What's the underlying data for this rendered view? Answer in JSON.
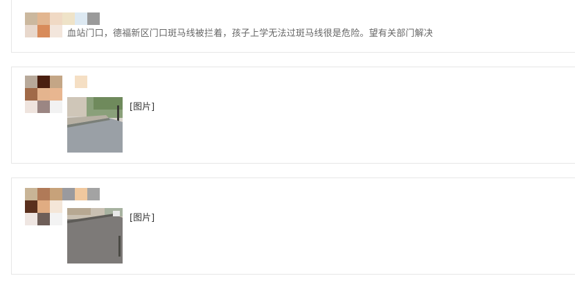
{
  "posts": [
    {
      "text": "血站门口，德福新区门口斑马线被拦着，孩子上学无法过斑马线很是危险。望有关部门解决"
    },
    {
      "image_label": "[图片]"
    },
    {
      "image_label": "[图片]"
    }
  ]
}
